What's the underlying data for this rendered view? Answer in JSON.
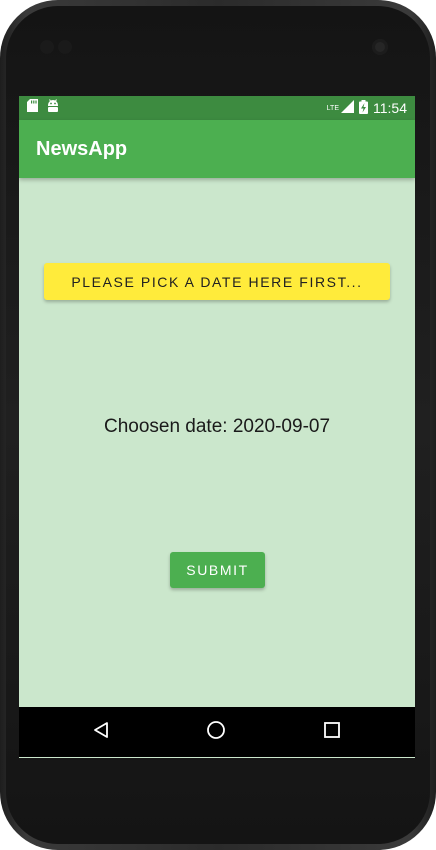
{
  "status_bar": {
    "time": "11:54",
    "network": "LTE",
    "left_icons": [
      "sd-card-icon",
      "android-icon"
    ],
    "right_icons": [
      "signal-icon",
      "battery-charging-icon"
    ]
  },
  "app_bar": {
    "title": "NewsApp"
  },
  "main": {
    "pick_date_label": "PLEASE PICK A DATE HERE FIRST...",
    "chosen_date_text": "Choosen date: 2020-09-07",
    "submit_label": "SUBMIT"
  },
  "nav_bar": {
    "buttons": [
      "back-icon",
      "home-icon",
      "recents-icon"
    ]
  },
  "colors": {
    "primary": "#4caf50",
    "primary_dark": "#3d8b40",
    "background": "#cbe7cc",
    "accent": "#ffeb3b"
  }
}
